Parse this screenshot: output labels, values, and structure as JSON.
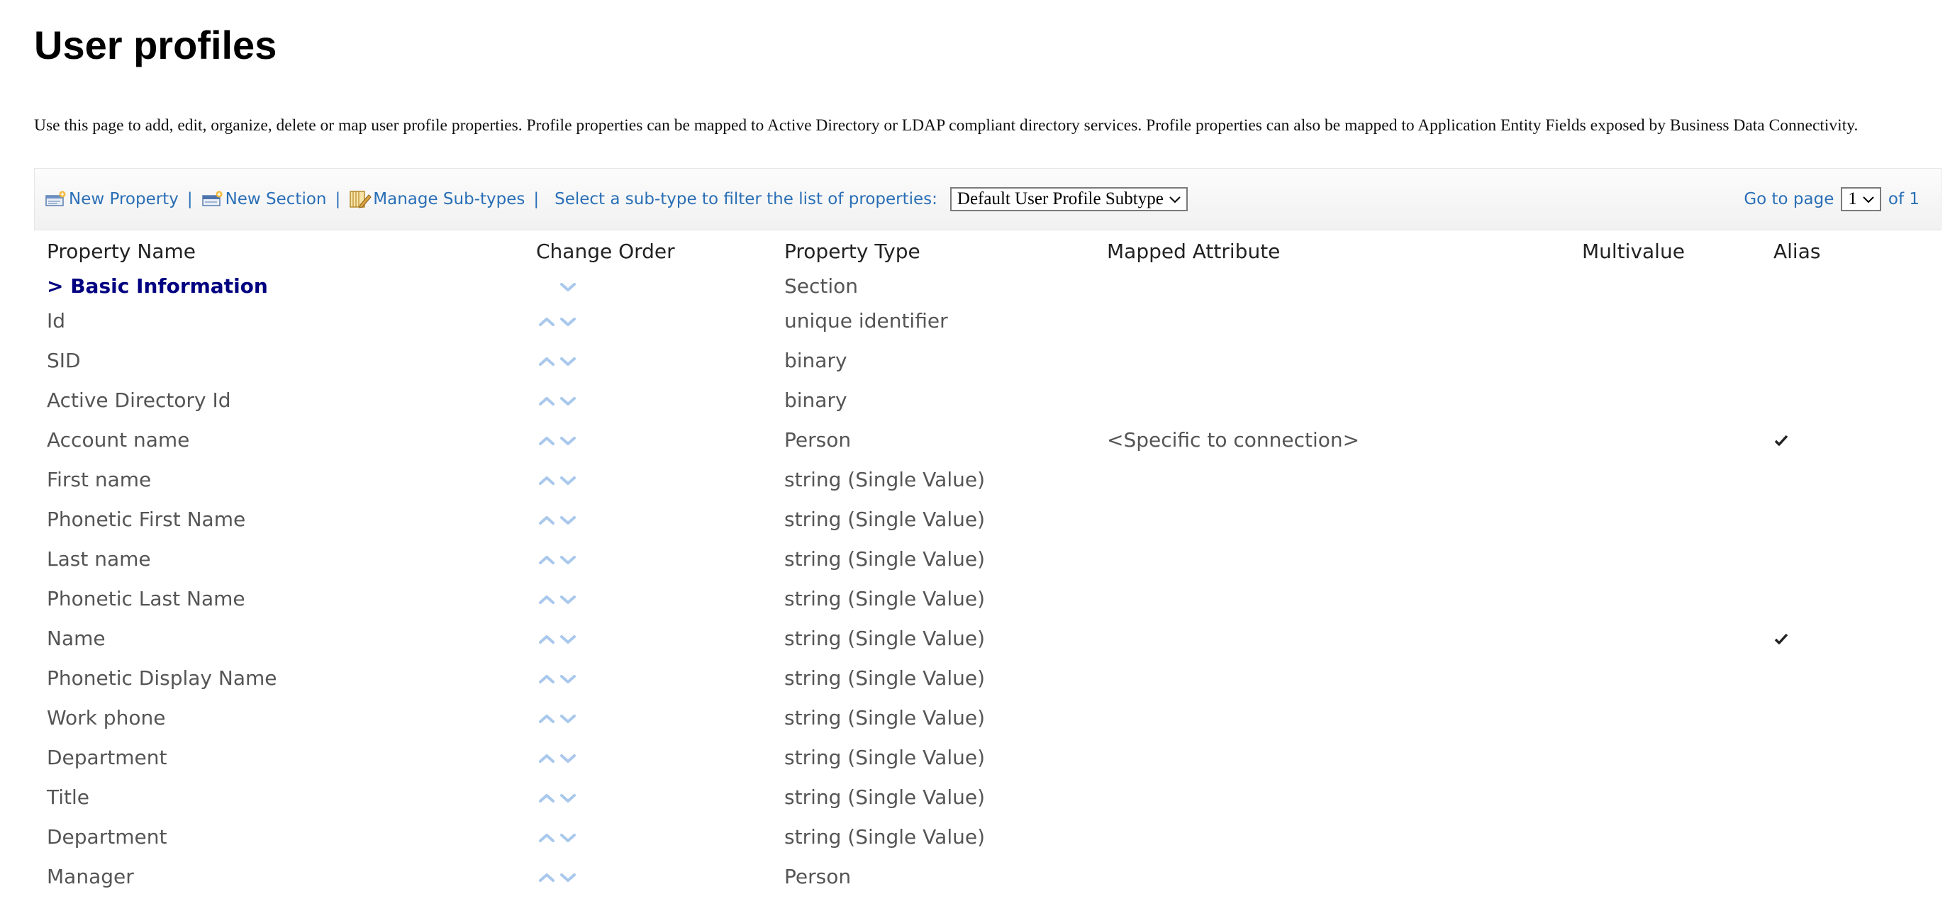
{
  "page": {
    "title": "User profiles",
    "description": "Use this page to add, edit, organize, delete or map user profile properties. Profile properties can be mapped to Active Directory or LDAP compliant directory services. Profile properties can also be mapped to Application Entity Fields exposed by Business Data Connectivity."
  },
  "toolbar": {
    "new_property": "New Property",
    "new_section": "New Section",
    "manage_subtypes": "Manage Sub-types",
    "separator": "|",
    "filter_label": "Select a sub-type to filter the list of properties:",
    "subtype_selected": "Default User Profile Subtype",
    "go_to_page": "Go to page",
    "page_selected": "1",
    "of_pages": "of 1",
    "icons": [
      "new-property-icon",
      "new-section-icon",
      "manage-subtypes-icon"
    ]
  },
  "table": {
    "columns": {
      "property_name": "Property Name",
      "change_order": "Change Order",
      "property_type": "Property Type",
      "mapped_attribute": "Mapped Attribute",
      "multivalue": "Multivalue",
      "alias": "Alias"
    },
    "section": {
      "name": "> Basic Information",
      "type": "Section"
    },
    "rows": [
      {
        "name": "Id",
        "type": "unique identifier",
        "mapped": "",
        "multivalue": "",
        "alias": false
      },
      {
        "name": "SID",
        "type": "binary",
        "mapped": "",
        "multivalue": "",
        "alias": false
      },
      {
        "name": "Active Directory Id",
        "type": "binary",
        "mapped": "",
        "multivalue": "",
        "alias": false
      },
      {
        "name": "Account name",
        "type": "Person",
        "mapped": "<Specific to connection>",
        "multivalue": "",
        "alias": true
      },
      {
        "name": "First name",
        "type": "string (Single Value)",
        "mapped": "",
        "multivalue": "",
        "alias": false
      },
      {
        "name": "Phonetic First Name",
        "type": "string (Single Value)",
        "mapped": "",
        "multivalue": "",
        "alias": false
      },
      {
        "name": "Last name",
        "type": "string (Single Value)",
        "mapped": "",
        "multivalue": "",
        "alias": false
      },
      {
        "name": "Phonetic Last Name",
        "type": "string (Single Value)",
        "mapped": "",
        "multivalue": "",
        "alias": false
      },
      {
        "name": "Name",
        "type": "string (Single Value)",
        "mapped": "",
        "multivalue": "",
        "alias": true
      },
      {
        "name": "Phonetic Display Name",
        "type": "string (Single Value)",
        "mapped": "",
        "multivalue": "",
        "alias": false
      },
      {
        "name": "Work phone",
        "type": "string (Single Value)",
        "mapped": "",
        "multivalue": "",
        "alias": false
      },
      {
        "name": "Department",
        "type": "string (Single Value)",
        "mapped": "",
        "multivalue": "",
        "alias": false
      },
      {
        "name": "Title",
        "type": "string (Single Value)",
        "mapped": "",
        "multivalue": "",
        "alias": false
      },
      {
        "name": "Department",
        "type": "string (Single Value)",
        "mapped": "",
        "multivalue": "",
        "alias": false
      },
      {
        "name": "Manager",
        "type": "Person",
        "mapped": "",
        "multivalue": "",
        "alias": false
      }
    ]
  },
  "colors": {
    "link": "#2a6fb6",
    "section_heading": "#000080",
    "arrow": "#a9c8ec",
    "text": "#555555"
  }
}
